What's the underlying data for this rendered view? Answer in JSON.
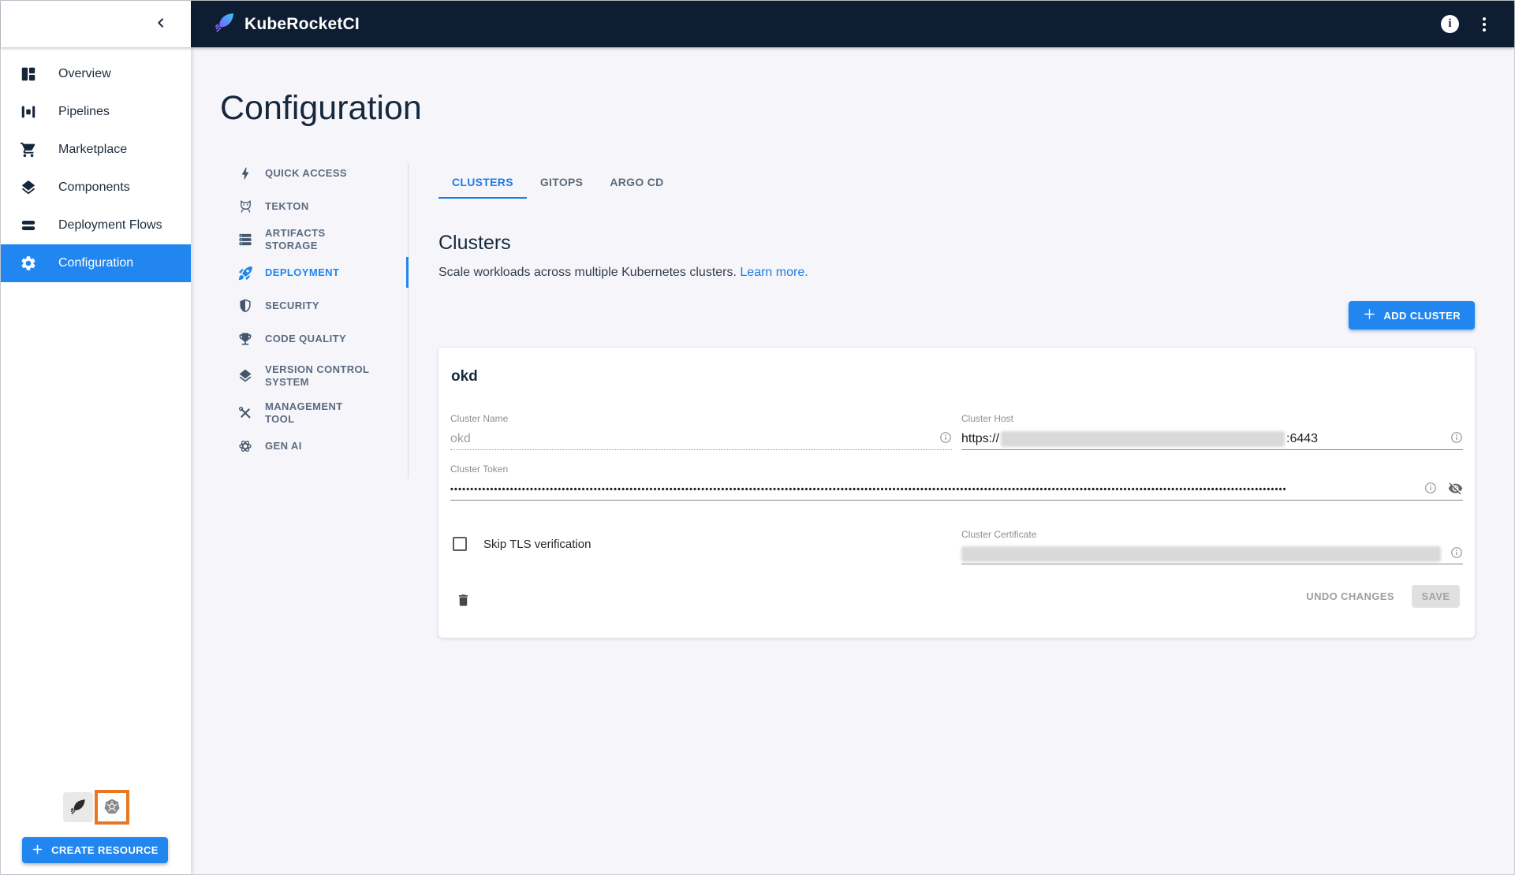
{
  "colors": {
    "primary_blue": "#2186f0",
    "tab_active_blue": "#1d7ce8",
    "header_bg": "#0e1d32",
    "highlight_orange": "#e87722",
    "page_bg": "#f6f6fa"
  },
  "header": {
    "app_title": "KubeRocketCI"
  },
  "sidebar": {
    "items": [
      {
        "label": "Overview",
        "icon": "dashboard-icon",
        "active": false
      },
      {
        "label": "Pipelines",
        "icon": "pipelines-icon",
        "active": false
      },
      {
        "label": "Marketplace",
        "icon": "cart-icon",
        "active": false
      },
      {
        "label": "Components",
        "icon": "layers-icon",
        "active": false
      },
      {
        "label": "Deployment Flows",
        "icon": "flows-icon",
        "active": false
      },
      {
        "label": "Configuration",
        "icon": "gear-icon",
        "active": true
      }
    ],
    "create_resource_label": "CREATE RESOURCE"
  },
  "page": {
    "title": "Configuration"
  },
  "config_nav": {
    "items": [
      {
        "label": "QUICK ACCESS",
        "icon": "bolt-icon",
        "active": false
      },
      {
        "label": "TEKTON",
        "icon": "tekton-cat-icon",
        "active": false
      },
      {
        "label": "ARTIFACTS STORAGE",
        "icon": "storage-icon",
        "active": false
      },
      {
        "label": "DEPLOYMENT",
        "icon": "rocket-icon",
        "active": true
      },
      {
        "label": "SECURITY",
        "icon": "shield-icon",
        "active": false
      },
      {
        "label": "CODE QUALITY",
        "icon": "trophy-icon",
        "active": false
      },
      {
        "label": "VERSION CONTROL SYSTEM",
        "icon": "layers-icon",
        "active": false
      },
      {
        "label": "MANAGEMENT TOOL",
        "icon": "tools-icon",
        "active": false
      },
      {
        "label": "GEN AI",
        "icon": "gen-ai-icon",
        "active": false
      }
    ]
  },
  "tabs": [
    {
      "label": "CLUSTERS",
      "active": true
    },
    {
      "label": "GITOPS",
      "active": false
    },
    {
      "label": "ARGO CD",
      "active": false
    }
  ],
  "section": {
    "heading": "Clusters",
    "description": "Scale workloads across multiple Kubernetes clusters.",
    "learn_more_label": "Learn more.",
    "add_cluster_label": "ADD CLUSTER"
  },
  "cluster_card": {
    "name": "okd",
    "fields": {
      "cluster_name": {
        "label": "Cluster Name",
        "value": "okd",
        "disabled": true
      },
      "cluster_host": {
        "label": "Cluster Host",
        "prefix": "https://",
        "suffix": ":6443",
        "redacted": true
      },
      "cluster_token": {
        "label": "Cluster Token",
        "masked_value": "••••••••••••••••••••••••••••••••••••••••••••••••••••••••••••••••••••••••••••••••••••••••••••••••••••••••••••••••••••••••••••••••••••••••••••••••••••••••••••••••••••••••••••••••••••••••••••••••••••••••••••••••••"
      },
      "skip_tls": {
        "label": "Skip TLS verification",
        "checked": false
      },
      "cluster_certificate": {
        "label": "Cluster Certificate",
        "redacted": true
      }
    },
    "actions": {
      "undo_label": "UNDO CHANGES",
      "save_label": "SAVE"
    }
  }
}
